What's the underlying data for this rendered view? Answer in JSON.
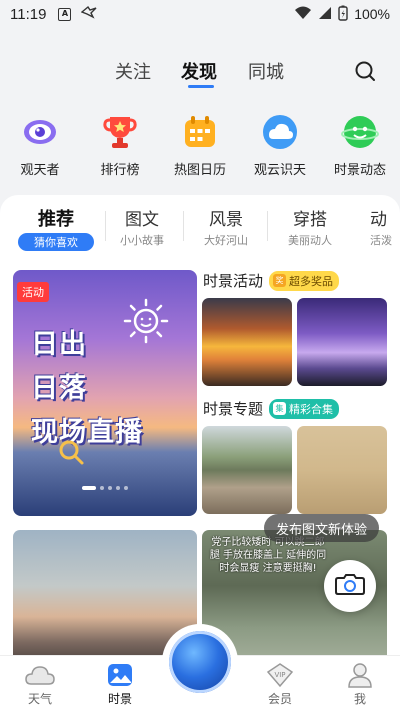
{
  "status_bar": {
    "time": "11:19",
    "battery": "100%"
  },
  "top_nav": {
    "tabs": [
      "关注",
      "发现",
      "同城"
    ],
    "active": "发现"
  },
  "quick_links": [
    {
      "label": "观天者",
      "icon": "eye-icon"
    },
    {
      "label": "排行榜",
      "icon": "trophy-icon"
    },
    {
      "label": "热图日历",
      "icon": "calendar-icon"
    },
    {
      "label": "观云识天",
      "icon": "cloud-icon"
    },
    {
      "label": "时景动态",
      "icon": "planet-icon"
    }
  ],
  "sub_tabs": [
    {
      "title": "推荐",
      "subtitle": "猜你喜欢"
    },
    {
      "title": "图文",
      "subtitle": "小小故事"
    },
    {
      "title": "风景",
      "subtitle": "大好河山"
    },
    {
      "title": "穿搭",
      "subtitle": "美丽动人"
    },
    {
      "title": "动",
      "subtitle": "活泼"
    }
  ],
  "banner": {
    "badge": "活动",
    "lines": [
      "日出",
      "日落",
      "现场直播"
    ]
  },
  "sections": {
    "activity": {
      "title": "时景活动",
      "pill": "超多奖品",
      "pill_icon": "奖"
    },
    "topics": {
      "title": "时景专题",
      "pill": "精彩合集",
      "pill_icon": "集"
    }
  },
  "feed_card_text": "党子比较矮时 可以跳二郎腿 手放在膝盖上 延伸的同时会显瘦 注意要挺胸!",
  "publish_tip": "发布图文新体验",
  "bottom_nav": [
    {
      "label": "天气",
      "icon": "cloud-icon"
    },
    {
      "label": "时景",
      "icon": "photo-icon"
    },
    {
      "label": "会员",
      "icon": "vip-icon"
    },
    {
      "label": "我",
      "icon": "person-icon"
    }
  ],
  "colors": {
    "accent": "#2f7cf6",
    "activity_badge": "#ff3b3b"
  }
}
